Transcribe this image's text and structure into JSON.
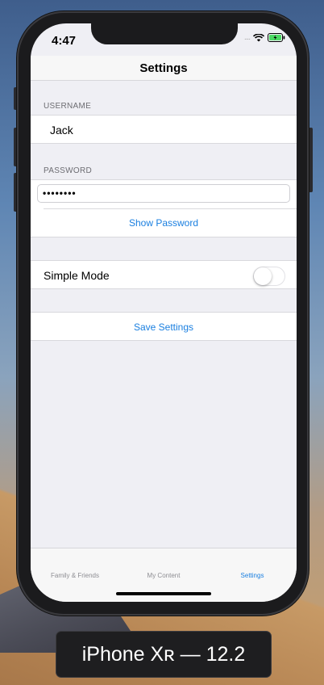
{
  "device_label": "iPhone Xʀ — 12.2",
  "status_bar": {
    "time": "4:47",
    "signal_icon": "signal-dots-icon",
    "wifi_icon": "wifi-icon",
    "battery_icon": "battery-charging-icon",
    "battery_color": "#4cd964"
  },
  "navbar": {
    "title": "Settings"
  },
  "username_section": {
    "header": "USERNAME",
    "value": "Jack"
  },
  "password_section": {
    "header": "PASSWORD",
    "value": "••••••••",
    "show_label": "Show Password"
  },
  "simple_mode": {
    "label": "Simple Mode",
    "enabled": false
  },
  "save_button": {
    "label": "Save Settings"
  },
  "tabs": [
    {
      "label": "Family & Friends",
      "active": false
    },
    {
      "label": "My Content",
      "active": false
    },
    {
      "label": "Settings",
      "active": true
    }
  ],
  "colors": {
    "accent": "#1a7fe0",
    "background": "#efeff4"
  }
}
